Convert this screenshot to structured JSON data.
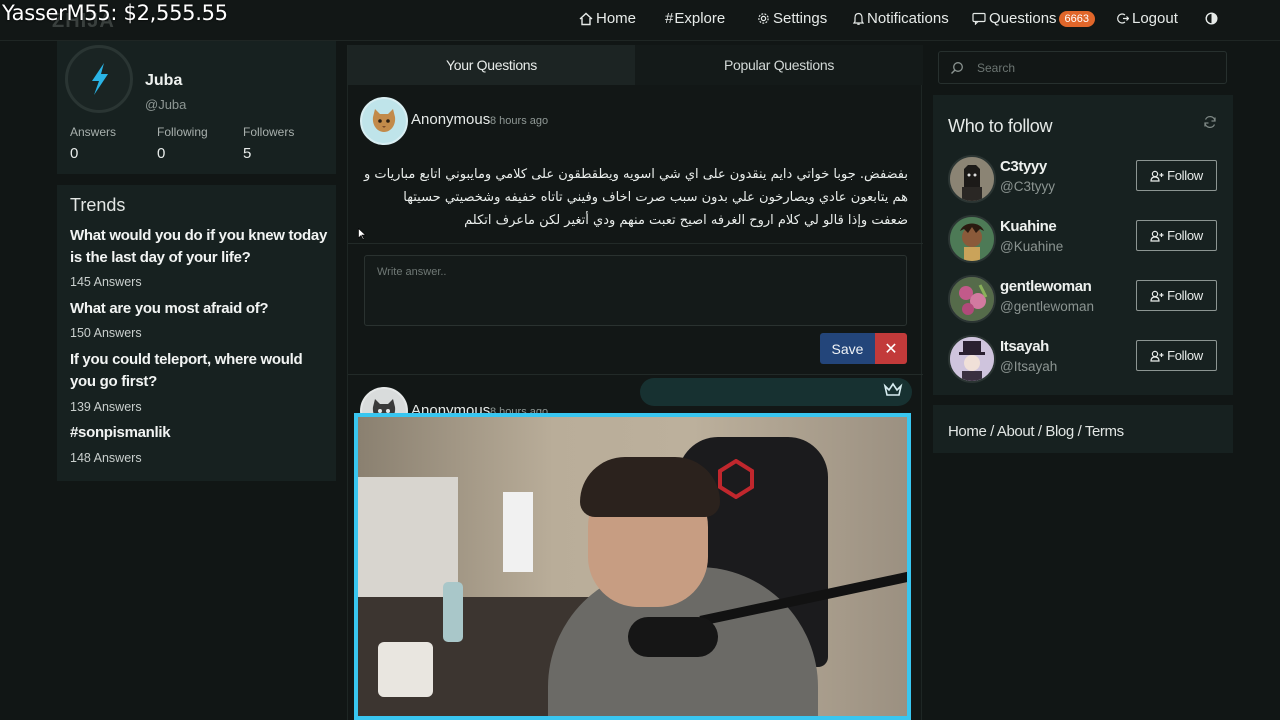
{
  "overlay": {
    "money_text": "YasserM55: $2,555.55"
  },
  "brand": {
    "logo_text": "ZHIJA"
  },
  "nav": {
    "home": "Home",
    "explore": "Explore",
    "settings": "Settings",
    "notifications": "Notifications",
    "questions": "Questions",
    "questions_count": "6663",
    "logout": "Logout"
  },
  "profile": {
    "name": "Juba",
    "handle": "@Juba",
    "answers_label": "Answers",
    "answers": "0",
    "following_label": "Following",
    "following": "0",
    "followers_label": "Followers",
    "followers": "5"
  },
  "trends": {
    "title": "Trends",
    "items": [
      {
        "question": "What would you do if you knew today is the last day of your life?",
        "answers": "145 Answers"
      },
      {
        "question": "What are you most afraid of?",
        "answers": "150 Answers"
      },
      {
        "question": "If you could teleport, where would you go first?",
        "answers": "139 Answers"
      },
      {
        "question": "#sonpismanlik",
        "answers": "148 Answers"
      }
    ]
  },
  "tabs": {
    "yours": "Your Questions",
    "popular": "Popular Questions"
  },
  "question1": {
    "author": "Anonymous",
    "time": "8 hours ago",
    "text": "بفضفض. جوبا خواتي دايم ينقدون على اي شي اسويه ويطقطقون على كلامي ومايبوني اتابع مباريات و هم يتابعون عادي ويصارخون علي بدون سبب صرت اخاف وفيني تاتاه خفيفه وشخصيتي حسيتها ضعفت وإذا قالو لي كلام اروح الغرفه اصيح تعبت منهم ودي أتغير لكن ماعرف اتكلم"
  },
  "answer": {
    "placeholder": "Write answer..",
    "save": "Save",
    "close": "✕"
  },
  "question2": {
    "author": "Anonymous",
    "time": "8 hours ago"
  },
  "search": {
    "placeholder": "Search"
  },
  "who_to_follow": {
    "title": "Who to follow",
    "follow_label": "Follow",
    "users": [
      {
        "name": "C3tyyy",
        "handle": "@C3tyyy"
      },
      {
        "name": "Kuahine",
        "handle": "@Kuahine"
      },
      {
        "name": "gentlewoman",
        "handle": "@gentlewoman"
      },
      {
        "name": "Itsayah",
        "handle": "@Itsayah"
      }
    ]
  },
  "footer_links": {
    "text": "Home / About / Blog / Terms"
  },
  "colors": {
    "accent": "#e0662a",
    "save": "#23457a",
    "danger": "#c23a3a",
    "webcam_border": "#39c6f0"
  }
}
